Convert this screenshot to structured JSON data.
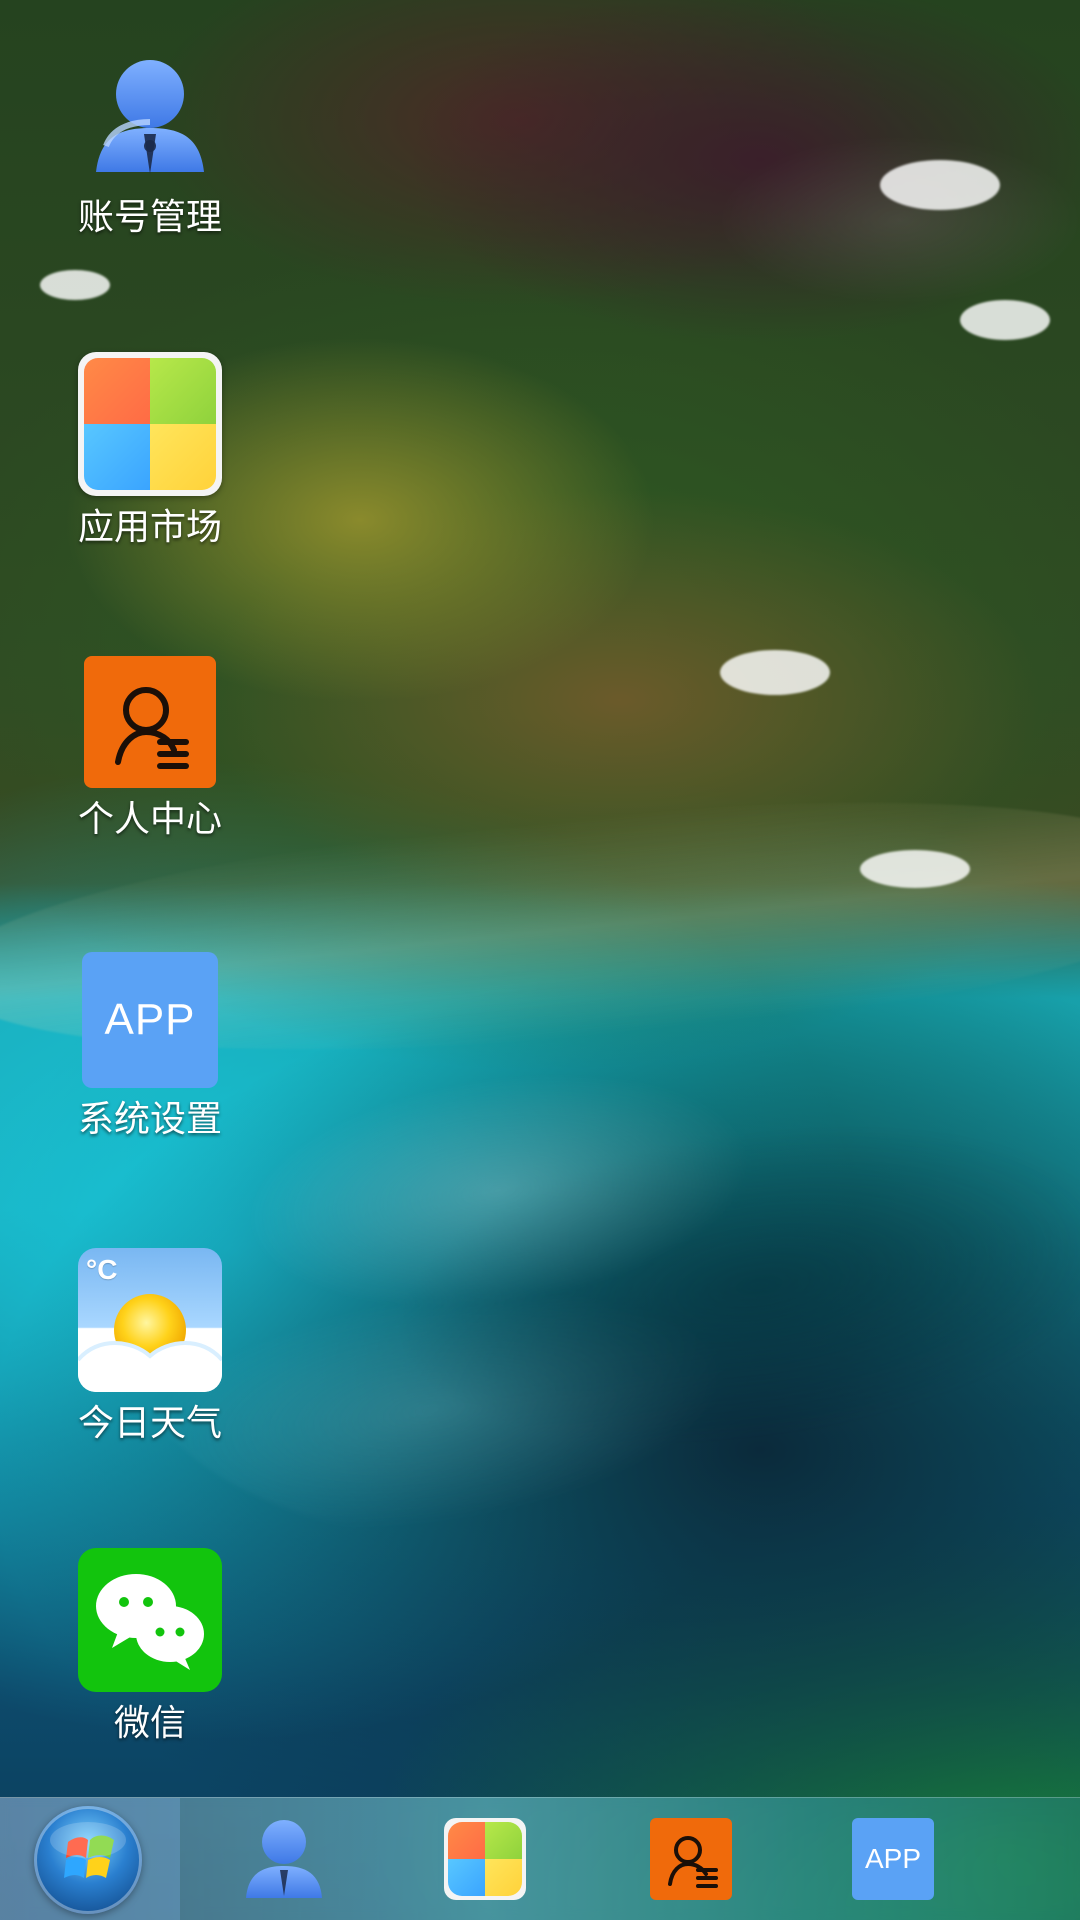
{
  "desktop": {
    "apps": [
      {
        "label": "账号管理",
        "icon": "account-icon"
      },
      {
        "label": "应用市场",
        "icon": "app-market-icon"
      },
      {
        "label": "个人中心",
        "icon": "personal-center-icon"
      },
      {
        "label": "系统设置",
        "icon": "app-icon",
        "icon_text": "APP"
      },
      {
        "label": "今日天气",
        "icon": "weather-icon",
        "icon_text": "°C"
      },
      {
        "label": "微信",
        "icon": "wechat-icon"
      }
    ]
  },
  "taskbar": {
    "start_button": "windows-start-orb-icon",
    "pinned": [
      {
        "icon": "account-icon"
      },
      {
        "icon": "app-market-icon"
      },
      {
        "icon": "personal-center-icon"
      },
      {
        "icon": "app-icon",
        "icon_text": "APP"
      }
    ]
  },
  "colors": {
    "account_blue": "#4f86ea",
    "market_orange": "#ff7a46",
    "market_green": "#a7df43",
    "market_blue": "#4ab7ff",
    "market_yellow": "#ffdf49",
    "personal_orange": "#f06a0b",
    "app_blue": "#5aa2f5",
    "wechat_green": "#12c40d"
  }
}
